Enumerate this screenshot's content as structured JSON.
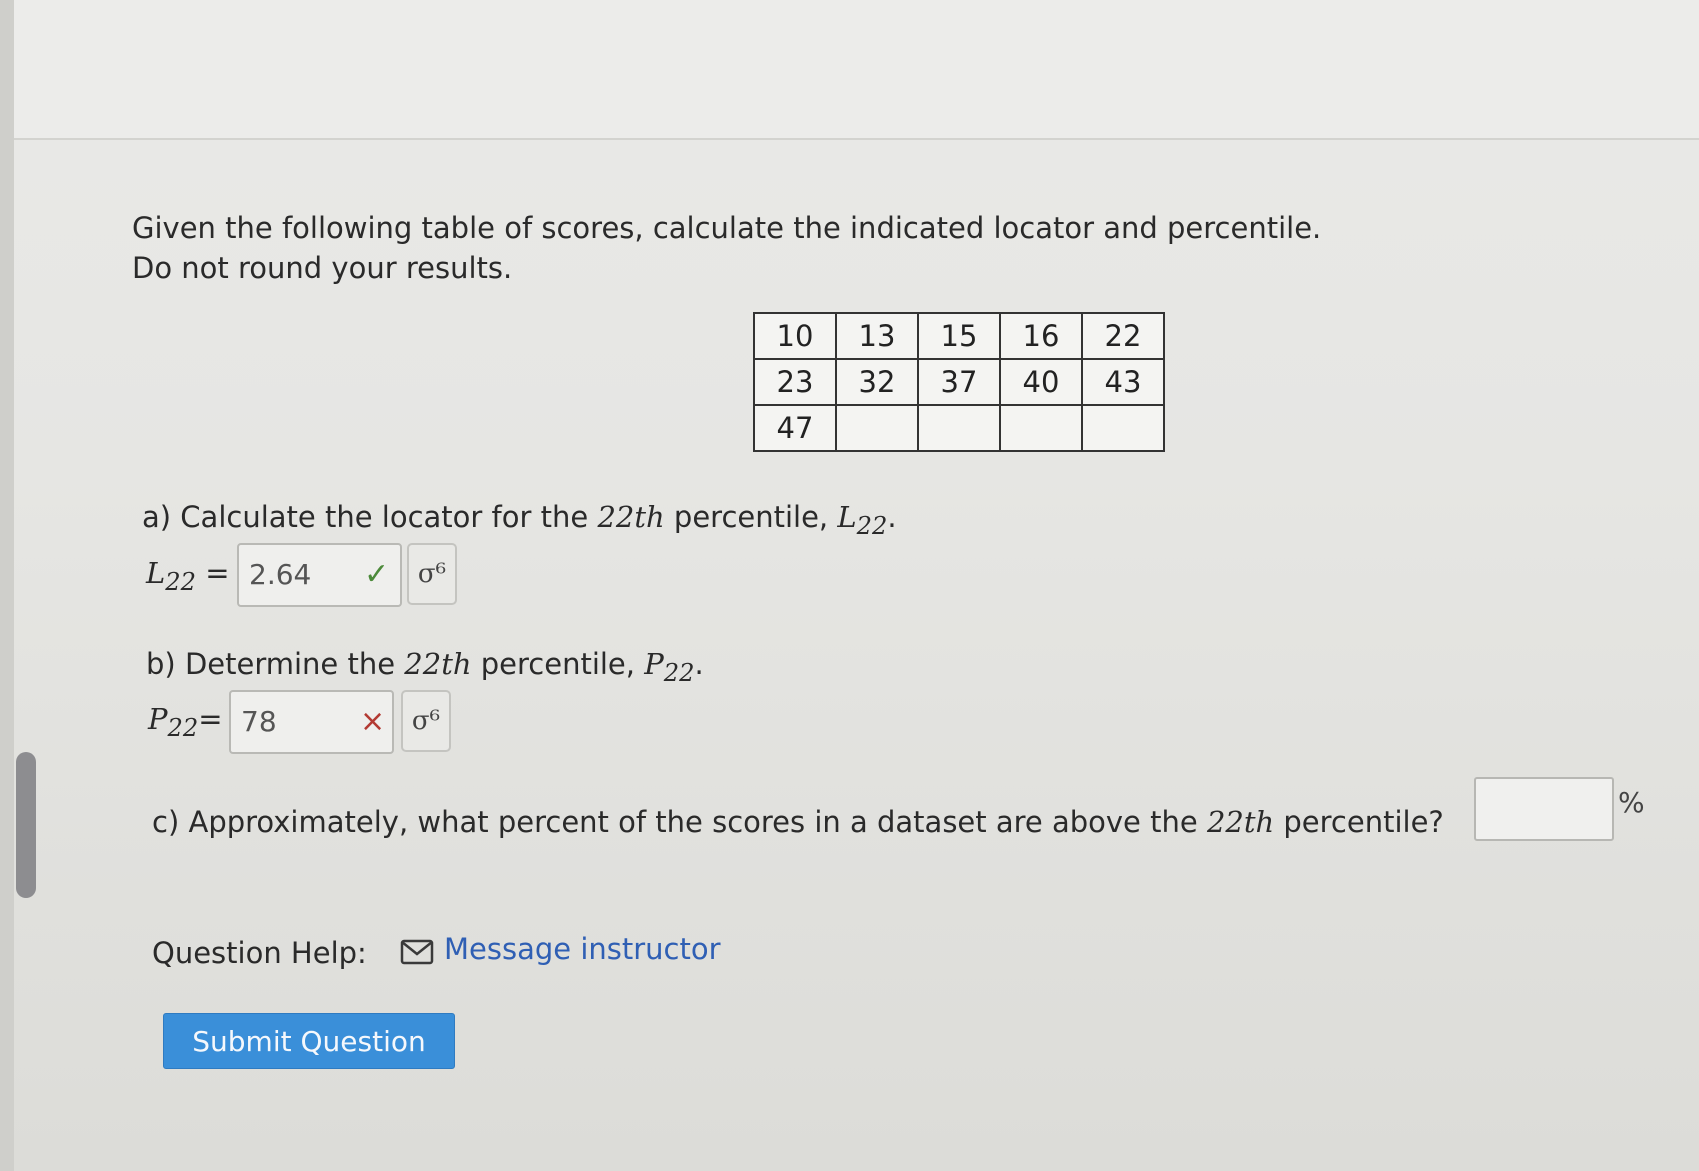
{
  "question": {
    "prompt_line1": "Given the following table of scores, calculate the indicated locator and percentile.",
    "prompt_line2": "Do not round your results."
  },
  "scores_table": {
    "rows": [
      [
        "10",
        "13",
        "15",
        "16",
        "22"
      ],
      [
        "23",
        "32",
        "37",
        "40",
        "43"
      ],
      [
        "47",
        "",
        "",
        "",
        ""
      ]
    ]
  },
  "part_a": {
    "prefix": "a) Calculate the locator for the ",
    "ordinal": "22th",
    "middle": " percentile, ",
    "symbol": "L",
    "subscript": "22",
    "suffix": ".",
    "answer_label_symbol": "L",
    "answer_label_sub": "22",
    "answer_label_eq": " =",
    "answer_value": "2.64",
    "status": "✓",
    "preview_icon": "σ⁶"
  },
  "part_b": {
    "prefix": "b) Determine the ",
    "ordinal": "22th",
    "middle": " percentile, ",
    "symbol": "P",
    "subscript": "22",
    "suffix": ".",
    "answer_label_symbol": "P",
    "answer_label_sub": "22",
    "answer_label_eq": "=",
    "answer_value": "78",
    "status": "×",
    "preview_icon": "σ⁶"
  },
  "part_c": {
    "prefix": "c) Approximately, what percent of the scores in a dataset are above the ",
    "ordinal": "22th",
    "suffix": " percentile?",
    "answer_value": "",
    "unit": "%"
  },
  "help": {
    "label": "Question Help:",
    "link_text": "Message instructor",
    "icon": "mail-icon"
  },
  "submit": {
    "label": "Submit Question",
    "color": "#3a8fd9"
  },
  "colors": {
    "correct": "#4c8a3a",
    "incorrect": "#b33a33",
    "link": "#2f5fb4"
  }
}
